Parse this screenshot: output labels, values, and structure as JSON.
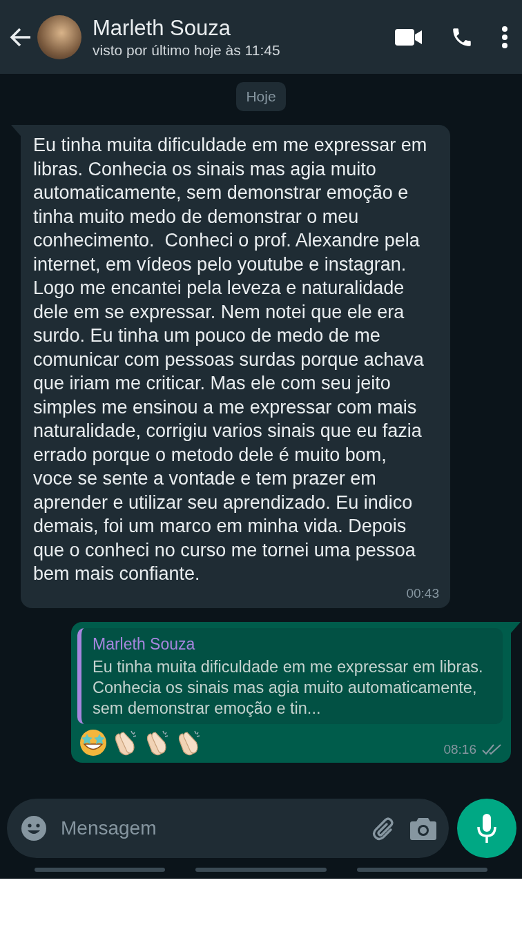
{
  "header": {
    "contact_name": "Marleth Souza",
    "last_seen": "visto por último hoje às 11:45"
  },
  "date_chip": "Hoje",
  "messages": [
    {
      "kind": "incoming",
      "text": "Eu tinha muita dificuldade em me expressar em libras. Conhecia os sinais mas agia muito automaticamente, sem demonstrar emoção e tinha muito medo de demonstrar o meu conhecimento.  Conheci o prof. Alexandre pela internet, em vídeos pelo youtube e instagran. Logo me encantei pela leveza e naturalidade dele em se expressar. Nem notei que ele era surdo. Eu tinha um pouco de medo de me comunicar com pessoas surdas porque achava que iriam me criticar. Mas ele com seu jeito simples me ensinou a me expressar com mais naturalidade, corrigiu varios sinais que eu fazia errado porque o metodo dele é muito bom, voce se sente a vontade e tem prazer em aprender e utilizar seu aprendizado. Eu indico demais, foi um marco em minha vida. Depois que o conheci no curso me tornei uma pessoa bem mais confiante.",
      "time": "00:43"
    },
    {
      "kind": "outgoing",
      "quote": {
        "author": "Marleth Souza",
        "text": "Eu tinha muita dificuldade em me expressar em libras. Conhecia os sinais mas agia muito automaticamente, sem demonstrar emoção e tin..."
      },
      "emojis": [
        {
          "kind": "star-struck"
        },
        {
          "kind": "clap"
        },
        {
          "kind": "clap"
        },
        {
          "kind": "clap"
        }
      ],
      "time": "08:16",
      "read": false
    }
  ],
  "composer": {
    "placeholder": "Mensagem"
  }
}
